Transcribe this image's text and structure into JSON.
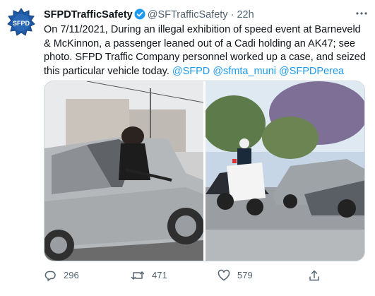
{
  "tweet": {
    "avatar_text": "SFPD",
    "display_name": "SFPDTrafficSafety",
    "handle": "@SFTrafficSafety",
    "separator": "·",
    "time": "22h",
    "body_text": "On 7/11/2021, During an illegal exhibition of speed event at Barneveld & McKinnon, a passenger leaned out of a Cadi holding an AK47; see photo. SFPD Traffic Company personnel worked up a case, and seized this particular vehicle today. ",
    "mentions": [
      "@SFPD",
      "@sfmta_muni",
      "@SFPDPerea"
    ],
    "replies": "296",
    "retweets": "471",
    "likes": "579"
  },
  "icons": {
    "verified": "verified-badge-icon",
    "more": "more-options-icon",
    "reply": "reply-icon",
    "retweet": "retweet-icon",
    "like": "heart-icon",
    "share": "share-icon"
  },
  "colors": {
    "accent": "#1d9bf0",
    "text": "#0f1419",
    "secondary": "#536471",
    "avatar_blue": "#1f5aa6"
  }
}
